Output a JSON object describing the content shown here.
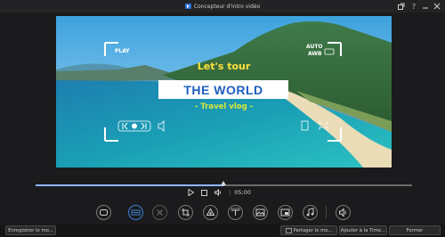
{
  "window": {
    "title": "Concepteur d'intro vidéo"
  },
  "titlebar_icons": [
    "expand-icon",
    "help-icon",
    "minimize-icon",
    "close-icon"
  ],
  "preview": {
    "headline_small": "Let's tour",
    "headline_big": "THE WORLD",
    "subtitle": "- Travel vlog -",
    "frame_top_left": "PLAY",
    "frame_top_right_1": "AUTO",
    "frame_top_right_2": "AWB"
  },
  "playback": {
    "time": "05;00",
    "progress_fraction": 0.5
  },
  "tools": [
    "template-icon",
    "customize-icon",
    "remove-icon",
    "crop-icon",
    "stickers-icon",
    "text-icon",
    "background-image-icon",
    "picture-in-picture-icon",
    "music-icon",
    "audio-icon"
  ],
  "bottom": {
    "save": "Enregistrer le mo...",
    "share": "Partager le mo...",
    "add": "Ajouter à la Time...",
    "close": "Fermer"
  },
  "colors": {
    "accent": "#3d7fd9",
    "headline_yellow": "#ffe23a",
    "world_blue": "#1f5fbf"
  }
}
